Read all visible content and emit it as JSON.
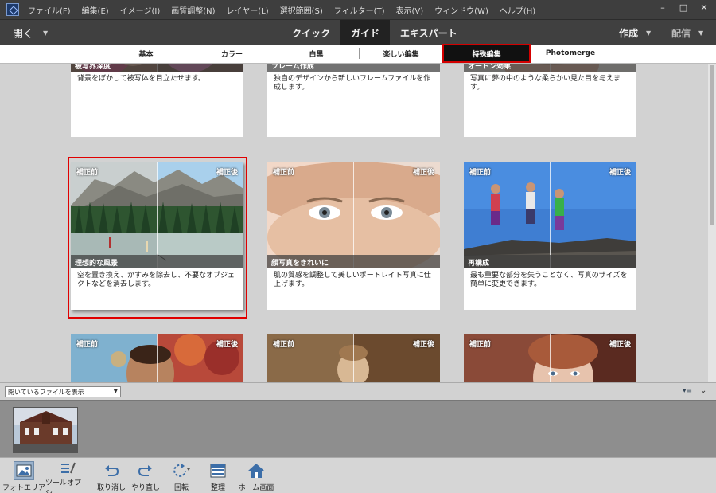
{
  "menubar": {
    "items": [
      "ファイル(F)",
      "編集(E)",
      "イメージ(I)",
      "画質調整(N)",
      "レイヤー(L)",
      "選択範囲(S)",
      "フィルター(T)",
      "表示(V)",
      "ウィンドウ(W)",
      "ヘルプ(H)"
    ],
    "window_controls": [
      "–",
      "□",
      "✕"
    ]
  },
  "modebar": {
    "open_label": "開く",
    "tabs": [
      "クイック",
      "ガイド",
      "エキスパート"
    ],
    "active_tab": "ガイド",
    "create_label": "作成",
    "share_label": "配信"
  },
  "category_tabs": [
    "基本",
    "カラー",
    "白黒",
    "楽しい編集",
    "特殊編集",
    "Photomerge"
  ],
  "cards_top": [
    {
      "title": "被写界深度",
      "desc": "背景をぼかして被写体を目立たせます。"
    },
    {
      "title": "フレーム作成",
      "desc": "独自のデザインから新しいフレームファイルを作成します。"
    },
    {
      "title": "オートン効果",
      "desc": "写真に夢の中のような柔らかい見た目を与えます。"
    }
  ],
  "cards_middle": [
    {
      "title": "理想的な風景",
      "desc": "空を置き換え、かすみを除去し、不要なオブジェクトなどを消去します。",
      "before": "補正前",
      "after": "補正後"
    },
    {
      "title": "顔写真をきれいに",
      "desc": "肌の質感を調整して美しいポートレイト写真に仕上げます。",
      "before": "補正前",
      "after": "補正後"
    },
    {
      "title": "再構成",
      "desc": "最も重要な部分を失うことなく、写真のサイズを簡単に変更できます。",
      "before": "補正前",
      "after": "補正後"
    }
  ],
  "cards_bottom": [
    {
      "before": "補正前",
      "after": "補正後"
    },
    {
      "before": "補正前",
      "after": "補正後"
    },
    {
      "before": "補正前",
      "after": "補正後"
    }
  ],
  "photobin": {
    "select_value": "開いているファイルを表示"
  },
  "taskbar": [
    {
      "label": "フォトエリア",
      "icon": "photo-area-icon"
    },
    {
      "label": "ツールオプシ...",
      "icon": "tool-options-icon"
    },
    {
      "label": "取り消し",
      "icon": "undo-icon"
    },
    {
      "label": "やり直し",
      "icon": "redo-icon"
    },
    {
      "label": "回転",
      "icon": "rotate-icon"
    },
    {
      "label": "整理",
      "icon": "organize-icon"
    },
    {
      "label": "ホーム画面",
      "icon": "home-icon"
    }
  ]
}
